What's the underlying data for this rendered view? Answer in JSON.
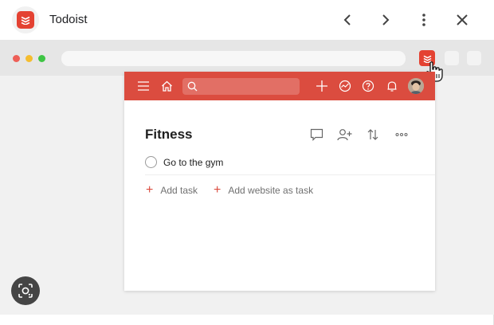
{
  "app": {
    "title": "Todoist"
  },
  "project": {
    "title": "Fitness",
    "tasks": [
      {
        "label": "Go to the gym"
      }
    ],
    "add_task_label": "Add task",
    "add_website_label": "Add website as task"
  },
  "colors": {
    "brand": "#db4c3f",
    "logo": "#e44232"
  }
}
